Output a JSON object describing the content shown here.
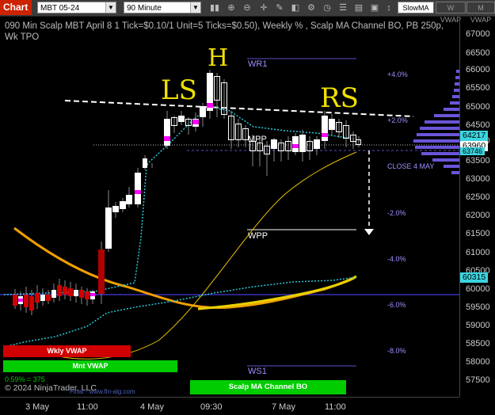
{
  "toolbar": {
    "chart_tab": "Chart",
    "instrument": "MBT 05-24",
    "interval": "90 Minute",
    "icons": [
      "bar-style-icon",
      "zoom-in-icon",
      "zoom-out-icon",
      "crosshair-icon",
      "draw-icon",
      "instrument-icon",
      "strategy-icon",
      "time-icon",
      "properties-icon",
      "data-box-icon",
      "screenshot-icon"
    ],
    "indicator_buttons": [
      "SlowMA",
      "W VWAP",
      "M VWAP"
    ]
  },
  "title_line": "090 Min Scalp MBT April 8 1 Tick=$0.10/1 Unit=5 Ticks=$0.50), Weekly % , Scalp MA Channel BO, PB 250p, Wk TPO",
  "annotations": {
    "left_shoulder": "LS",
    "head": "H",
    "right_shoulder": "RS",
    "wr1": "WR1",
    "mpp": "MPP",
    "wpp": "WPP",
    "ws1": "WS1",
    "close_label": "CLOSE 4 MAY"
  },
  "weekly_pct_labels": [
    "+4.0%",
    "+2.0%",
    "-2.0%",
    "-4.0%",
    "-6.0%",
    "-8.0%"
  ],
  "price_tags": [
    {
      "value": "64217",
      "color": "#3bd4e0"
    },
    {
      "value": "63960",
      "color": "#ffffff"
    },
    {
      "value": "63746",
      "color": "#3bd4e0"
    },
    {
      "value": "60315",
      "color": "#3bd4e0"
    }
  ],
  "y_axis_ticks": [
    "67000",
    "66500",
    "66000",
    "65500",
    "65000",
    "64500",
    "64000",
    "63500",
    "63000",
    "62500",
    "62000",
    "61500",
    "61000",
    "60500",
    "60000",
    "59500",
    "59000",
    "58500",
    "58000",
    "57500"
  ],
  "x_axis_ticks": [
    "3 May",
    "11:00",
    "4 May",
    "09:30",
    "7 May",
    "11:00"
  ],
  "bars": {
    "weekly_vwap": "Wkly VWAP",
    "monthly_vwap": "Mnt VWAP",
    "scalp_bo": "Scalp MA Channel BO"
  },
  "footer": {
    "stat": "0.59% = 375",
    "copyright": "© 2024 NinjaTrader, LLC",
    "site": "Final - www.fin-alg.com"
  },
  "colors": {
    "up_candle": "#ffffff",
    "down_candle": "#d00000",
    "highlight": "#ff00ff",
    "ma_cyan": "#29c8d8",
    "ma_orange": "#f0a000",
    "ma_yellow": "#e8d000",
    "tpo": "#6a55d8"
  }
}
